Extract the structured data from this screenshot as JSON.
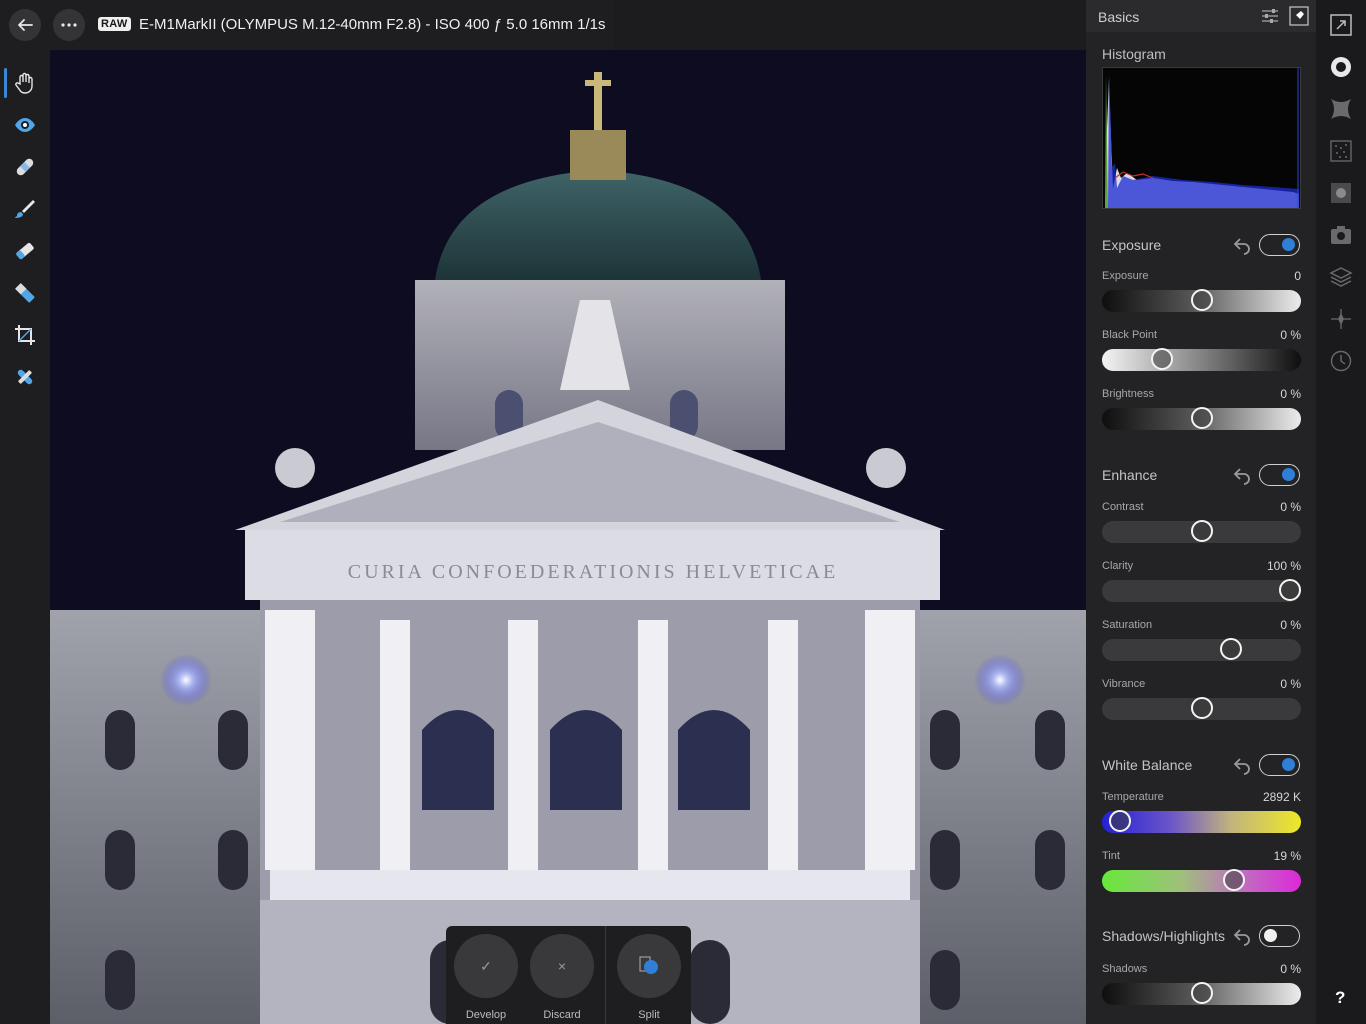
{
  "top_bar": {
    "raw_badge": "RAW",
    "photo_info": "E-M1MarkII (OLYMPUS M.12-40mm F2.8) - ISO 400 ƒ 5.0 16mm 1/1s"
  },
  "left_tools": [
    "hand-icon",
    "eye-icon",
    "bandage-icon",
    "brush-icon",
    "eraser-icon",
    "gradient-icon",
    "crop-icon",
    "repair-icon"
  ],
  "canvas": {
    "inscription": "CURIA CONFOEDERATIONIS HELVETICAE"
  },
  "action_bar": {
    "develop": {
      "symbol": "✓",
      "label": "Develop"
    },
    "discard": {
      "symbol": "×",
      "label": "Discard"
    },
    "split": {
      "label": "Split"
    }
  },
  "panel": {
    "title": "Basics",
    "histogram_label": "Histogram",
    "sections": {
      "exposure": {
        "title": "Exposure",
        "enabled": true,
        "exposure": {
          "label": "Exposure",
          "value": "0",
          "position": 0.5
        },
        "black_point": {
          "label": "Black Point",
          "value": "0 %",
          "position": 0.3
        },
        "brightness": {
          "label": "Brightness",
          "value": "0 %",
          "position": 0.5
        }
      },
      "enhance": {
        "title": "Enhance",
        "enabled": true,
        "contrast": {
          "label": "Contrast",
          "value": "0 %",
          "position": 0.5
        },
        "clarity": {
          "label": "Clarity",
          "value": "100 %",
          "position": 0.945
        },
        "saturation": {
          "label": "Saturation",
          "value": "0 %",
          "position": 0.65
        },
        "vibrance": {
          "label": "Vibrance",
          "value": "0 %",
          "position": 0.5
        }
      },
      "white_balance": {
        "title": "White Balance",
        "enabled": true,
        "temperature": {
          "label": "Temperature",
          "value": "2892 K",
          "position": 0.09
        },
        "tint": {
          "label": "Tint",
          "value": "19 %",
          "position": 0.665
        }
      },
      "shadows_highlights": {
        "title": "Shadows/Highlights",
        "enabled": false,
        "shadows": {
          "label": "Shadows",
          "value": "0 %",
          "position": 0.5
        }
      }
    }
  },
  "studio_icons": [
    "navigator-icon",
    "color-icon",
    "lens-icon",
    "noise-icon",
    "vignette-icon",
    "camera-icon",
    "layers-icon",
    "spot-icon",
    "history-icon"
  ],
  "help": "?",
  "colors": {
    "accent": "#2f7fd6",
    "panel_bg": "#232325",
    "toolbar_bg": "#1e1e20"
  }
}
